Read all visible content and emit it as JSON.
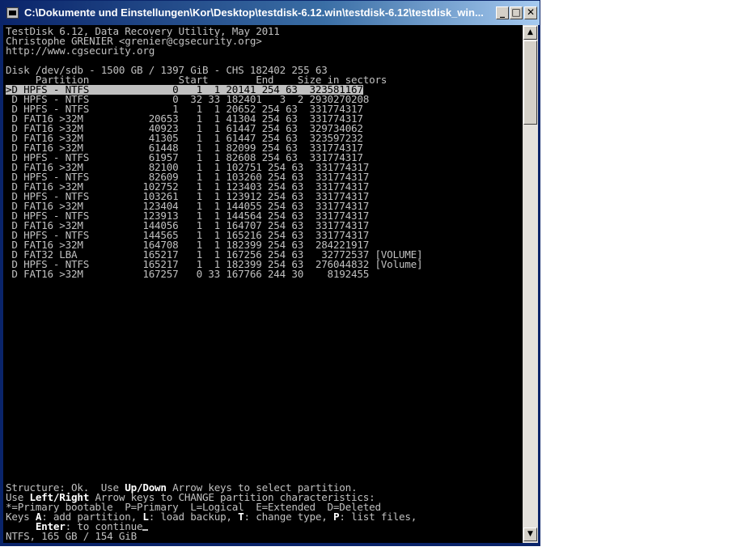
{
  "window": {
    "title": "C:\\Dokumente und Einstellungen\\Kor\\Desktop\\testdisk-6.12.win\\testdisk-6.12\\testdisk_win...",
    "minimize": "_",
    "maximize": "□",
    "close": "✕"
  },
  "header": {
    "line1": "TestDisk 6.12, Data Recovery Utility, May 2011",
    "line2": "Christophe GRENIER <grenier@cgsecurity.org>",
    "line3": "http://www.cgsecurity.org"
  },
  "disk_info": "Disk /dev/sdb - 1500 GB / 1397 GiB - CHS 182402 255 63",
  "table_header": "     Partition               Start        End    Size in sectors",
  "partitions": [
    ">D HPFS - NTFS              0   1  1 20141 254 63  323581167",
    " D HPFS - NTFS              0  32 33 182401   3  2 2930270208",
    " D HPFS - NTFS              1   1  1 20652 254 63  331774317",
    " D FAT16 >32M           20653   1  1 41304 254 63  331774317",
    " D FAT16 >32M           40923   1  1 61447 254 63  329734062",
    " D FAT16 >32M           41305   1  1 61447 254 63  323597232",
    " D FAT16 >32M           61448   1  1 82099 254 63  331774317",
    " D HPFS - NTFS          61957   1  1 82608 254 63  331774317",
    " D FAT16 >32M           82100   1  1 102751 254 63  331774317",
    " D HPFS - NTFS          82609   1  1 103260 254 63  331774317",
    " D FAT16 >32M          102752   1  1 123403 254 63  331774317",
    " D HPFS - NTFS         103261   1  1 123912 254 63  331774317",
    " D FAT16 >32M          123404   1  1 144055 254 63  331774317",
    " D HPFS - NTFS         123913   1  1 144564 254 63  331774317",
    " D FAT16 >32M          144056   1  1 164707 254 63  331774317",
    " D HPFS - NTFS         144565   1  1 165216 254 63  331774317",
    " D FAT16 >32M          164708   1  1 182399 254 63  284221917",
    " D FAT32 LBA           165217   1  1 167256 254 63   32772537 [VOLUME]",
    " D HPFS - NTFS         165217   1  1 182399 254 63  276044832 [Volume]",
    " D FAT16 >32M          167257   0 33 167766 244 30    8192455"
  ],
  "footer": {
    "structure_pre": "Structure: Ok.  Use ",
    "structure_key": "Up/Down",
    "structure_post": " Arrow keys to select partition.",
    "lr_pre": "Use ",
    "lr_key": "Left/Right",
    "lr_post": " Arrow keys to CHANGE partition characteristics:",
    "legend": "*=Primary bootable  P=Primary  L=Logical  E=Extended  D=Deleted",
    "keys_label": "Keys ",
    "key_a": "A",
    "key_a_desc": ": add partition, ",
    "key_l": "L",
    "key_l_desc": ": load backup, ",
    "key_t": "T",
    "key_t_desc": ": change type, ",
    "key_p": "P",
    "key_p_desc": ": list files,",
    "enter_indent": "     ",
    "enter_key": "Enter",
    "enter_desc": ": to continue",
    "status": "NTFS, 165 GB / 154 GiB"
  }
}
